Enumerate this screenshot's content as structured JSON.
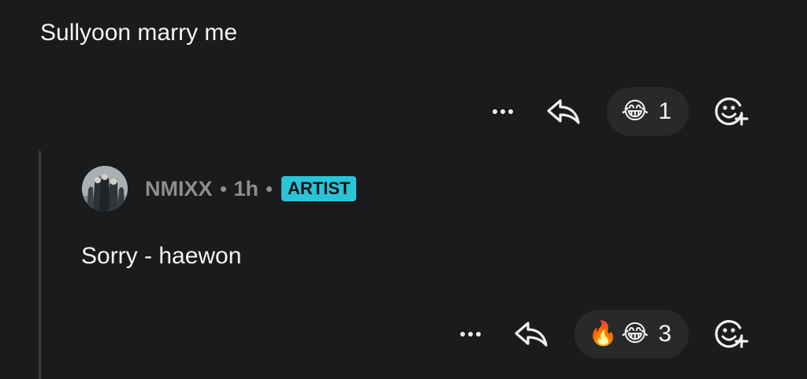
{
  "comment": {
    "text": "Sullyoon marry me",
    "reactions": {
      "emojis": [
        "😂"
      ],
      "count": "1"
    }
  },
  "reply": {
    "author": "NMIXX",
    "time": "1h",
    "badge": "ARTIST",
    "text": "Sorry - haewon",
    "reactions": {
      "emojis": [
        "🔥",
        "😂"
      ],
      "count": "3"
    }
  },
  "colors": {
    "background": "#191b1c",
    "badge": "#2bc3d6",
    "pill": "#27292b",
    "muted_text": "#8e8e8e"
  },
  "icons": {
    "more": "more-horizontal-icon",
    "reply": "reply-arrow-icon",
    "add_reaction": "add-reaction-smiley-icon"
  }
}
